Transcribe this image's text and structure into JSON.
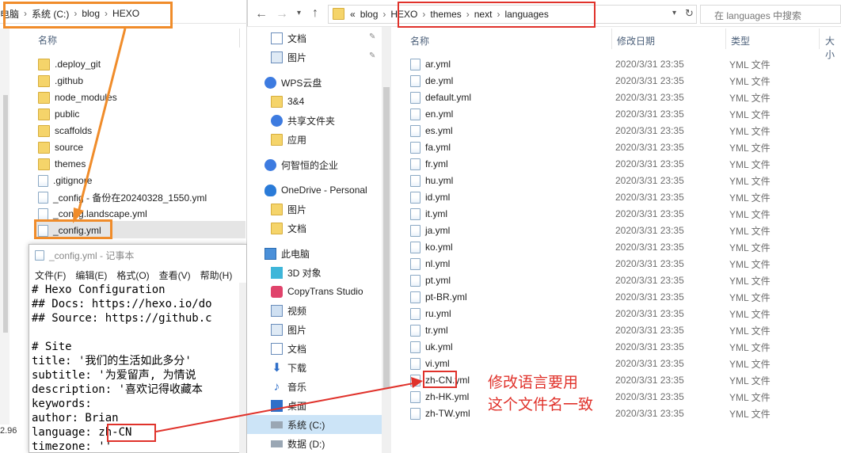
{
  "left_explorer": {
    "breadcrumb": [
      "电脑",
      "系统 (C:)",
      "blog",
      "HEXO"
    ],
    "column_name": "名称",
    "items": [
      {
        "name": ".deploy_git",
        "type": "folder"
      },
      {
        "name": ".github",
        "type": "folder"
      },
      {
        "name": "node_modules",
        "type": "folder"
      },
      {
        "name": "public",
        "type": "folder"
      },
      {
        "name": "scaffolds",
        "type": "folder"
      },
      {
        "name": "source",
        "type": "folder"
      },
      {
        "name": "themes",
        "type": "folder"
      },
      {
        "name": ".gitignore",
        "type": "file"
      },
      {
        "name": "_config - 备份在20240328_1550.yml",
        "type": "file"
      },
      {
        "name": "_config.landscape.yml",
        "type": "file"
      },
      {
        "name": "_config.yml",
        "type": "file"
      }
    ],
    "status_text": "2.96"
  },
  "notepad": {
    "title": "_config.yml - 记事本",
    "menu": [
      "文件(F)",
      "编辑(E)",
      "格式(O)",
      "查看(V)",
      "帮助(H)"
    ],
    "lines": [
      "# Hexo Configuration",
      "## Docs: https://hexo.io/do",
      "## Source: https://github.c",
      "",
      "# Site",
      "title: '我们的生活如此多分'",
      "subtitle: '为爱留声, 为情说",
      "description: '喜欢记得收藏本",
      "keywords:",
      "author: Brian",
      "language: zh-CN",
      "timezone: ''"
    ],
    "language_prefix": "language: ",
    "language_value": "zh-CN"
  },
  "right_explorer": {
    "address": {
      "overflow": "«",
      "crumbs": [
        "blog",
        "HEXO",
        "themes",
        "next",
        "languages"
      ]
    },
    "search_placeholder": "在 languages 中搜索",
    "nav": [
      {
        "label": "文档",
        "icon": "document-icon",
        "pinned": true
      },
      {
        "label": "图片",
        "icon": "picture-icon",
        "pinned": true
      },
      {
        "label": "WPS云盘",
        "icon": "cloud-icon",
        "pinned": false
      },
      {
        "label": "3&4",
        "icon": "folder-icon",
        "pinned": false
      },
      {
        "label": "共享文件夹",
        "icon": "share-icon",
        "pinned": false
      },
      {
        "label": "应用",
        "icon": "folder-icon",
        "pinned": false
      },
      {
        "label": "何智恒的企业",
        "icon": "cloud-icon",
        "pinned": false
      },
      {
        "label": "OneDrive - Personal",
        "icon": "cloud-icon",
        "pinned": false
      },
      {
        "label": "图片",
        "icon": "folder-icon",
        "pinned": false
      },
      {
        "label": "文档",
        "icon": "folder-icon",
        "pinned": false
      },
      {
        "label": "此电脑",
        "icon": "computer-icon",
        "pinned": false
      },
      {
        "label": "3D 对象",
        "icon": "cube-icon",
        "pinned": false
      },
      {
        "label": "CopyTrans Studio",
        "icon": "app-icon",
        "pinned": false
      },
      {
        "label": "视频",
        "icon": "video-icon",
        "pinned": false
      },
      {
        "label": "图片",
        "icon": "picture-icon",
        "pinned": false
      },
      {
        "label": "文档",
        "icon": "document-icon",
        "pinned": false
      },
      {
        "label": "下载",
        "icon": "download-icon",
        "pinned": false
      },
      {
        "label": "音乐",
        "icon": "music-icon",
        "pinned": false
      },
      {
        "label": "桌面",
        "icon": "desktop-icon",
        "pinned": false
      },
      {
        "label": "系统 (C:)",
        "icon": "drive-icon",
        "pinned": false
      },
      {
        "label": "数据 (D:)",
        "icon": "drive-icon",
        "pinned": false
      }
    ],
    "columns": {
      "name": "名称",
      "date": "修改日期",
      "type": "类型",
      "size": "大小"
    },
    "files": [
      {
        "name": "ar.yml",
        "date": "2020/3/31 23:35",
        "type": "YML 文件"
      },
      {
        "name": "de.yml",
        "date": "2020/3/31 23:35",
        "type": "YML 文件"
      },
      {
        "name": "default.yml",
        "date": "2020/3/31 23:35",
        "type": "YML 文件"
      },
      {
        "name": "en.yml",
        "date": "2020/3/31 23:35",
        "type": "YML 文件"
      },
      {
        "name": "es.yml",
        "date": "2020/3/31 23:35",
        "type": "YML 文件"
      },
      {
        "name": "fa.yml",
        "date": "2020/3/31 23:35",
        "type": "YML 文件"
      },
      {
        "name": "fr.yml",
        "date": "2020/3/31 23:35",
        "type": "YML 文件"
      },
      {
        "name": "hu.yml",
        "date": "2020/3/31 23:35",
        "type": "YML 文件"
      },
      {
        "name": "id.yml",
        "date": "2020/3/31 23:35",
        "type": "YML 文件"
      },
      {
        "name": "it.yml",
        "date": "2020/3/31 23:35",
        "type": "YML 文件"
      },
      {
        "name": "ja.yml",
        "date": "2020/3/31 23:35",
        "type": "YML 文件"
      },
      {
        "name": "ko.yml",
        "date": "2020/3/31 23:35",
        "type": "YML 文件"
      },
      {
        "name": "nl.yml",
        "date": "2020/3/31 23:35",
        "type": "YML 文件"
      },
      {
        "name": "pt.yml",
        "date": "2020/3/31 23:35",
        "type": "YML 文件"
      },
      {
        "name": "pt-BR.yml",
        "date": "2020/3/31 23:35",
        "type": "YML 文件"
      },
      {
        "name": "ru.yml",
        "date": "2020/3/31 23:35",
        "type": "YML 文件"
      },
      {
        "name": "tr.yml",
        "date": "2020/3/31 23:35",
        "type": "YML 文件"
      },
      {
        "name": "uk.yml",
        "date": "2020/3/31 23:35",
        "type": "YML 文件"
      },
      {
        "name": "vi.yml",
        "date": "2020/3/31 23:35",
        "type": "YML 文件"
      },
      {
        "name": "zh-CN.yml",
        "date": "2020/3/31 23:35",
        "type": "YML 文件"
      },
      {
        "name": "zh-HK.yml",
        "date": "2020/3/31 23:35",
        "type": "YML 文件"
      },
      {
        "name": "zh-TW.yml",
        "date": "2020/3/31 23:35",
        "type": "YML 文件"
      }
    ],
    "highlight_file_part": "zh-CN",
    "highlight_file_rest": ".yml"
  },
  "annotation": {
    "text_line1": "修改语言要用",
    "text_line2": "这个文件名一致",
    "color": "#e0322b",
    "orange": "#f08c2a"
  }
}
